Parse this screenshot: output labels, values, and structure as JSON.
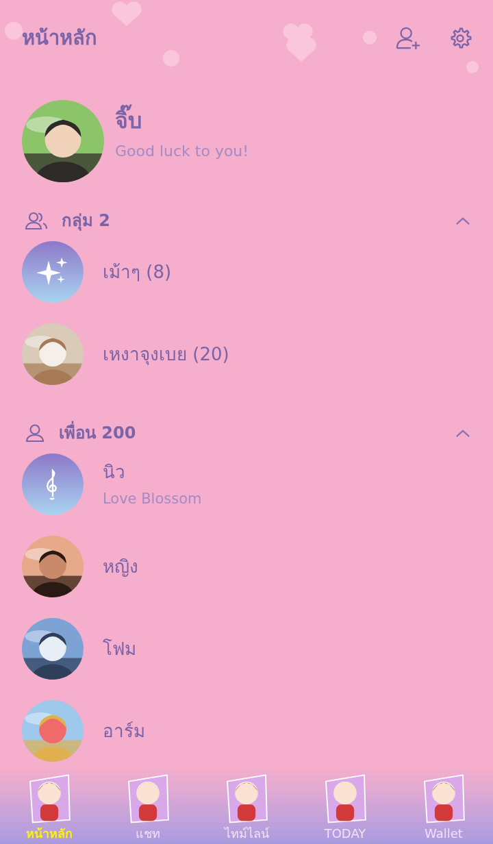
{
  "header": {
    "title": "หน้าหลัก"
  },
  "profile": {
    "name": "จิ๊บ",
    "status": "Good luck to you!"
  },
  "sections": [
    {
      "kind": "group",
      "title": "กลุ่ม 2",
      "expanded": true,
      "items": [
        {
          "name": "เม้าๆ (8)",
          "avatar": {
            "kind": "sparkle"
          }
        },
        {
          "name": "เหงาจุงเบย (20)"
        }
      ]
    },
    {
      "kind": "friend",
      "title": "เพื่อน 200",
      "expanded": true,
      "items": [
        {
          "name": "นิว",
          "subtitle": "Love Blossom",
          "avatar": {
            "kind": "music"
          }
        },
        {
          "name": "หญิง"
        },
        {
          "name": "โฟม"
        },
        {
          "name": "อาร์ม"
        }
      ]
    }
  ],
  "tabs": [
    {
      "label": "หน้าหลัก",
      "selected": true
    },
    {
      "label": "แชท",
      "selected": false
    },
    {
      "label": "ไทม์ไลน์",
      "selected": false
    },
    {
      "label": "TODAY",
      "selected": false
    },
    {
      "label": "Wallet",
      "selected": false
    }
  ]
}
